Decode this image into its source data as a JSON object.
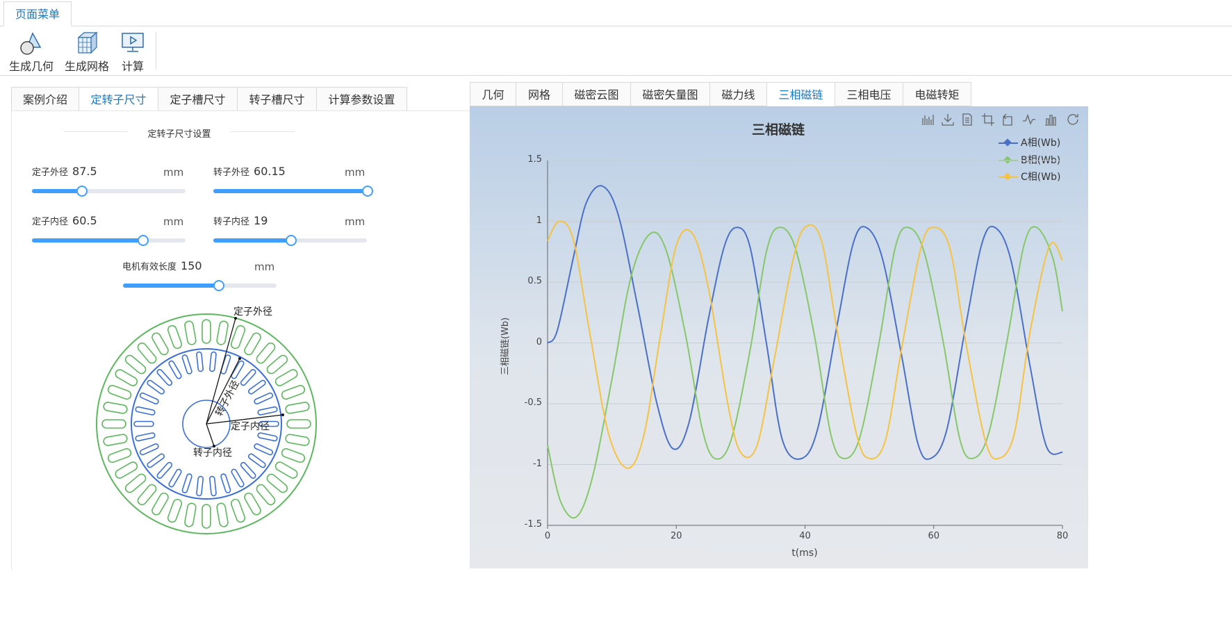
{
  "ribbon": {
    "tab": "页面菜单",
    "buttons": [
      {
        "label": "生成几何",
        "icon": "geometry-icon"
      },
      {
        "label": "生成网格",
        "icon": "mesh-icon"
      },
      {
        "label": "计算",
        "icon": "compute-icon"
      }
    ]
  },
  "left_tabs": [
    "案例介绍",
    "定转子尺寸",
    "定子槽尺寸",
    "转子槽尺寸",
    "计算参数设置"
  ],
  "left_active_tab": 1,
  "section_title": "定转子尺寸设置",
  "params": {
    "stator_outer": {
      "label": "定子外径",
      "value": "87.5",
      "unit": "mm",
      "fraction": 0.32
    },
    "rotor_outer": {
      "label": "转子外径",
      "value": "60.15",
      "unit": "mm",
      "fraction": 1.0
    },
    "stator_inner": {
      "label": "定子内径",
      "value": "60.5",
      "unit": "mm",
      "fraction": 0.72
    },
    "rotor_inner": {
      "label": "转子内径",
      "value": "19",
      "unit": "mm",
      "fraction": 0.5
    },
    "motor_length": {
      "label": "电机有效长度",
      "value": "150",
      "unit": "mm",
      "fraction": 0.62
    }
  },
  "diagram": {
    "stator_outer_label": "定子外径",
    "rotor_outer_label": "转子外径",
    "stator_inner_label": "定子内径",
    "rotor_inner_label": "转子内径",
    "stator_color": "#5cb85c",
    "rotor_color": "#3a6fd8"
  },
  "right_tabs": [
    "几何",
    "网格",
    "磁密云图",
    "磁密矢量图",
    "磁力线",
    "三相磁链",
    "三相电压",
    "电磁转矩"
  ],
  "right_active_tab": 5,
  "toolbar_icons": [
    "data-zoom-icon",
    "download-icon",
    "data-view-icon",
    "zoom-area-icon",
    "restore-icon",
    "line-chart-icon",
    "bar-chart-icon",
    "refresh-icon"
  ],
  "chart_data": {
    "type": "line",
    "title": "三相磁链",
    "xlabel": "t(ms)",
    "ylabel": "三相磁链(Wb)",
    "xlim": [
      0,
      80
    ],
    "ylim": [
      -1.5,
      1.5
    ],
    "xticks": [
      "0",
      "20",
      "40",
      "60",
      "80"
    ],
    "yticks": [
      "1.5",
      "1",
      "0.5",
      "0",
      "-0.5",
      "-1",
      "-1.5"
    ],
    "grid": true,
    "legend_position": "top-right",
    "series": [
      {
        "name": "A相(Wb)",
        "color": "#4a6fc7",
        "x": [
          0,
          1.5,
          4,
          6,
          8.5,
          11,
          14,
          17,
          19.5,
          22,
          25,
          27.5,
          29.5,
          31.5,
          34,
          36.5,
          39.5,
          42,
          45,
          47.5,
          49.5,
          52,
          55,
          57.5,
          59.5,
          62,
          65,
          67.5,
          69.5,
          72,
          75,
          77.5,
          80
        ],
        "y": [
          0.0,
          0.1,
          0.7,
          1.15,
          1.29,
          1.05,
          0.3,
          -0.5,
          -0.87,
          -0.65,
          0.2,
          0.8,
          0.95,
          0.78,
          0.0,
          -0.8,
          -0.95,
          -0.7,
          0.15,
          0.82,
          0.95,
          0.7,
          -0.1,
          -0.82,
          -0.95,
          -0.72,
          0.15,
          0.82,
          0.95,
          0.68,
          -0.2,
          -0.85,
          -0.9
        ]
      },
      {
        "name": "B相(Wb)",
        "color": "#85c76a",
        "x": [
          0,
          2,
          4.5,
          7,
          10,
          13,
          16,
          18.5,
          21.5,
          24,
          26,
          28.5,
          31.5,
          34,
          36,
          38.5,
          41.5,
          44,
          46,
          48.5,
          51.5,
          54,
          56,
          58.5,
          61.5,
          64,
          66,
          68.5,
          71.5,
          74,
          76,
          78.5,
          80
        ],
        "y": [
          -0.84,
          -1.3,
          -1.43,
          -1.1,
          -0.3,
          0.55,
          0.9,
          0.75,
          0.05,
          -0.7,
          -0.95,
          -0.8,
          -0.05,
          0.75,
          0.95,
          0.78,
          0.05,
          -0.75,
          -0.95,
          -0.78,
          0.0,
          0.78,
          0.95,
          0.75,
          0.0,
          -0.78,
          -0.95,
          -0.75,
          0.05,
          0.8,
          0.95,
          0.7,
          0.26
        ]
      },
      {
        "name": "C相(Wb)",
        "color": "#f5c242",
        "x": [
          0,
          1.8,
          4,
          6.5,
          9.5,
          12.5,
          15,
          17.5,
          20,
          22.5,
          25,
          28,
          30,
          32.5,
          35,
          38,
          40,
          42.5,
          45,
          48,
          50,
          52.5,
          55,
          58,
          60,
          62.5,
          65,
          68,
          70,
          72.5,
          75,
          78,
          80
        ],
        "y": [
          0.84,
          1.0,
          0.85,
          0.1,
          -0.75,
          -1.03,
          -0.75,
          0.05,
          0.8,
          0.9,
          0.45,
          -0.5,
          -0.9,
          -0.85,
          -0.2,
          0.65,
          0.95,
          0.85,
          0.1,
          -0.75,
          -0.95,
          -0.8,
          -0.05,
          0.78,
          0.95,
          0.78,
          0.0,
          -0.8,
          -0.95,
          -0.75,
          0.1,
          0.8,
          0.68
        ]
      }
    ]
  }
}
